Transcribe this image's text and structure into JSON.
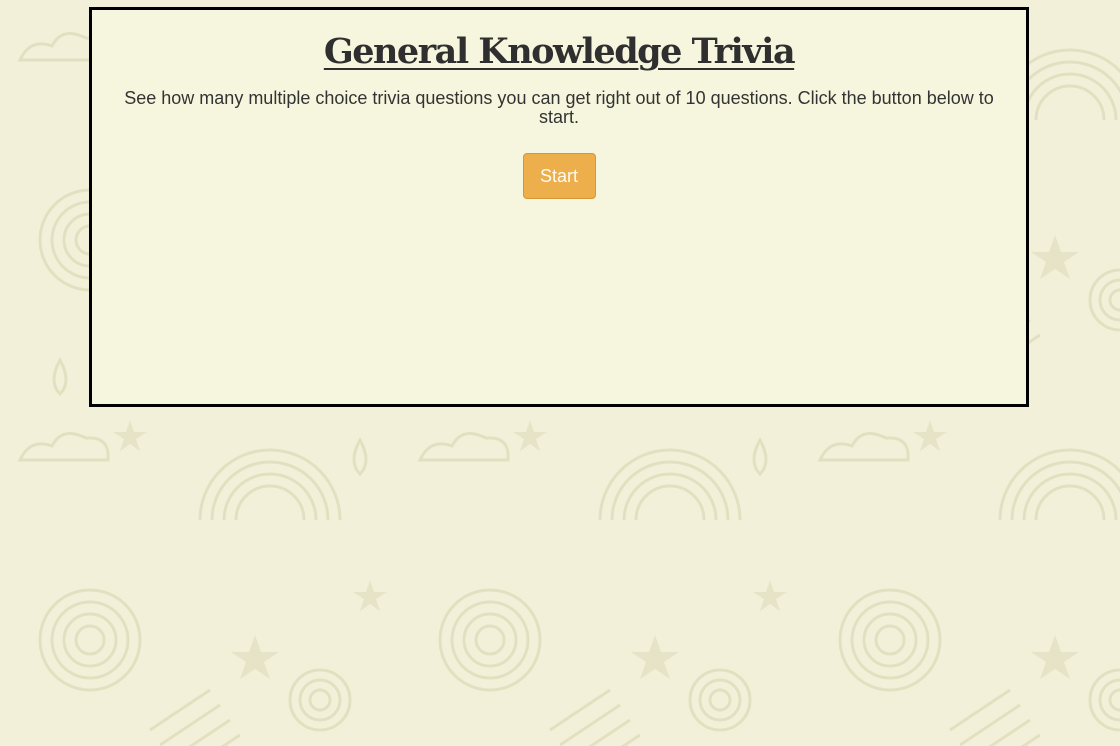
{
  "page": {
    "title": "General Knowledge Trivia",
    "description": "See how many multiple choice trivia questions you can get right out of 10 questions. Click the button below to start.",
    "start_label": "Start"
  },
  "colors": {
    "background": "#f2f0d8",
    "pattern": "#e4e1c3",
    "card_background": "#f6f6de",
    "card_border": "#000000",
    "button": "#ecaf4c",
    "button_text": "#fffbf0",
    "text": "#333333"
  }
}
